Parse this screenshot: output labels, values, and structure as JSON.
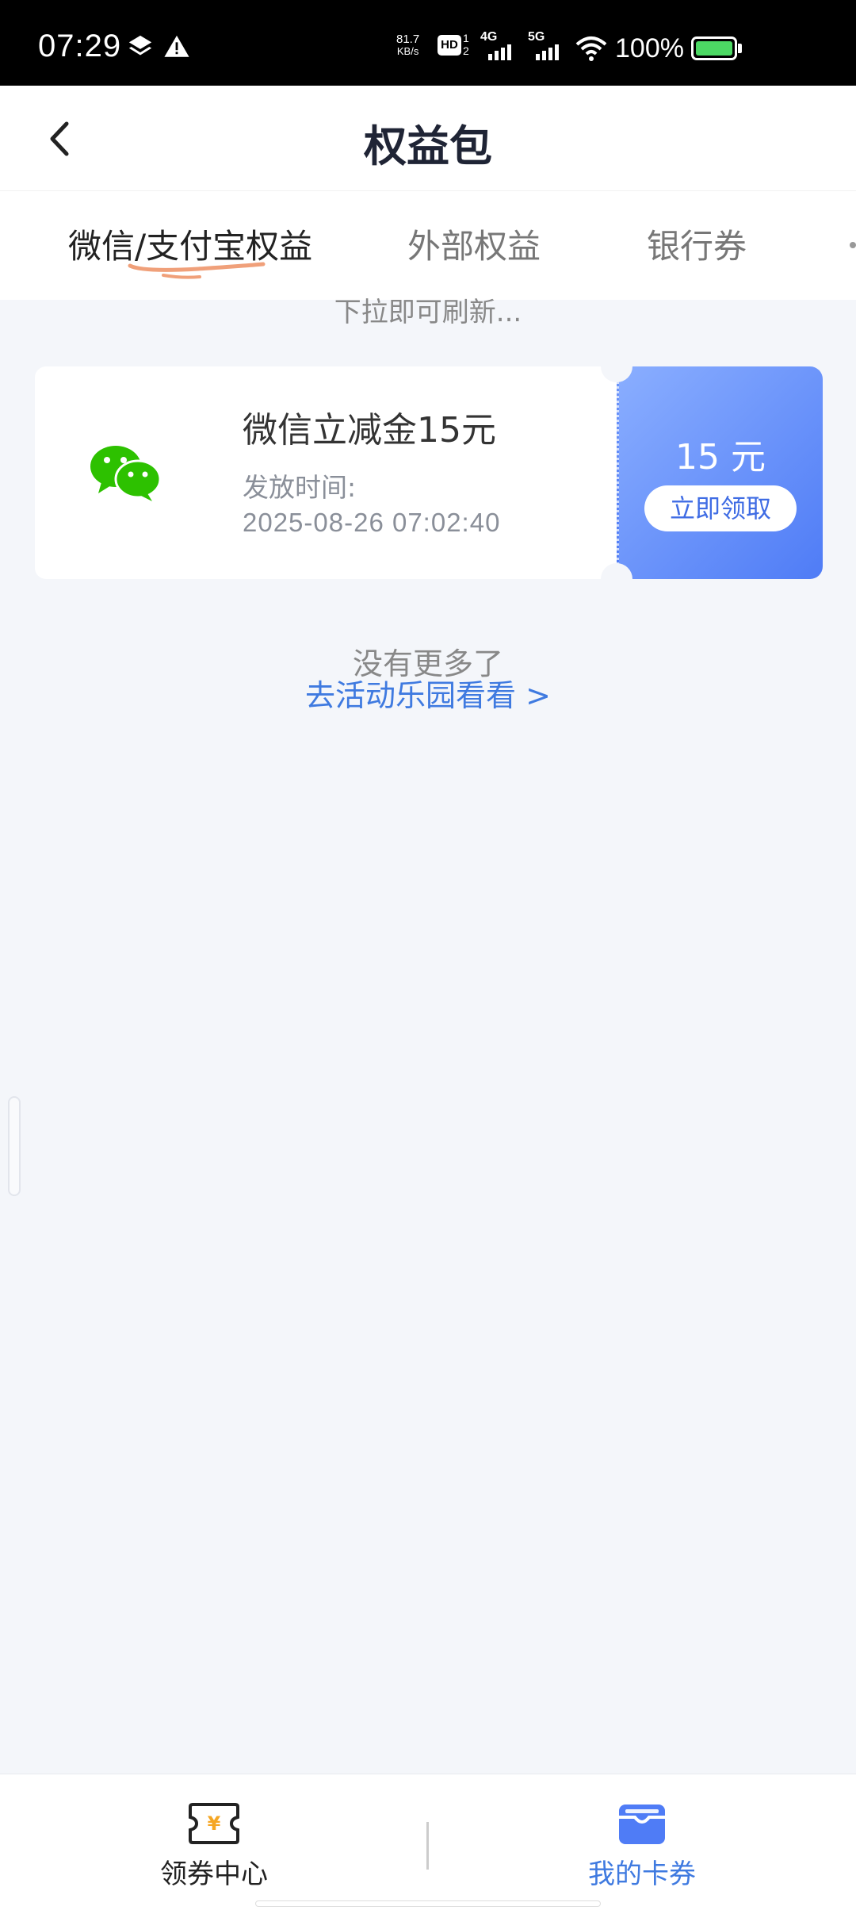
{
  "status_bar": {
    "time": "07:29",
    "net_speed_value": "81.7",
    "net_speed_unit": "KB/s",
    "hd_label": "HD",
    "hd_sub": "1\n2",
    "net_4g": "4G",
    "net_5g": "5G",
    "battery_text": "100%",
    "battery_level": 1.0,
    "battery_color": "#4cd964",
    "icons": [
      "layers-icon",
      "warning-icon",
      "signal-icon",
      "wifi-icon",
      "battery-icon"
    ]
  },
  "header": {
    "title": "权益包",
    "back_icon": "chevron-left-icon"
  },
  "tabs": [
    {
      "label": "微信/支付宝权益",
      "active": true
    },
    {
      "label": "外部权益",
      "active": false
    },
    {
      "label": "银行券",
      "active": false
    }
  ],
  "pull_hint": "下拉即可刷新...",
  "coupons": [
    {
      "icon": "wechat-icon",
      "title": "微信立减金15元",
      "time_label": "发放时间:",
      "time": "2025-08-26 07:02:40",
      "amount": "15 元",
      "action": "立即领取"
    }
  ],
  "footer": {
    "no_more": "没有更多了",
    "link": "去活动乐园看看 >"
  },
  "bottom_nav": [
    {
      "label": "领券中心",
      "icon": "coupon-yen-icon",
      "active": false
    },
    {
      "label": "我的卡券",
      "icon": "wallet-icon",
      "active": true
    }
  ],
  "colors": {
    "accent": "#3f7ae0",
    "card_gradient_start": "#8aaeff",
    "card_gradient_end": "#4f7cf6",
    "wechat_green": "#2dc100",
    "tab_underline": "#f0a07a",
    "coupon_icon_orange": "#f5a623"
  }
}
